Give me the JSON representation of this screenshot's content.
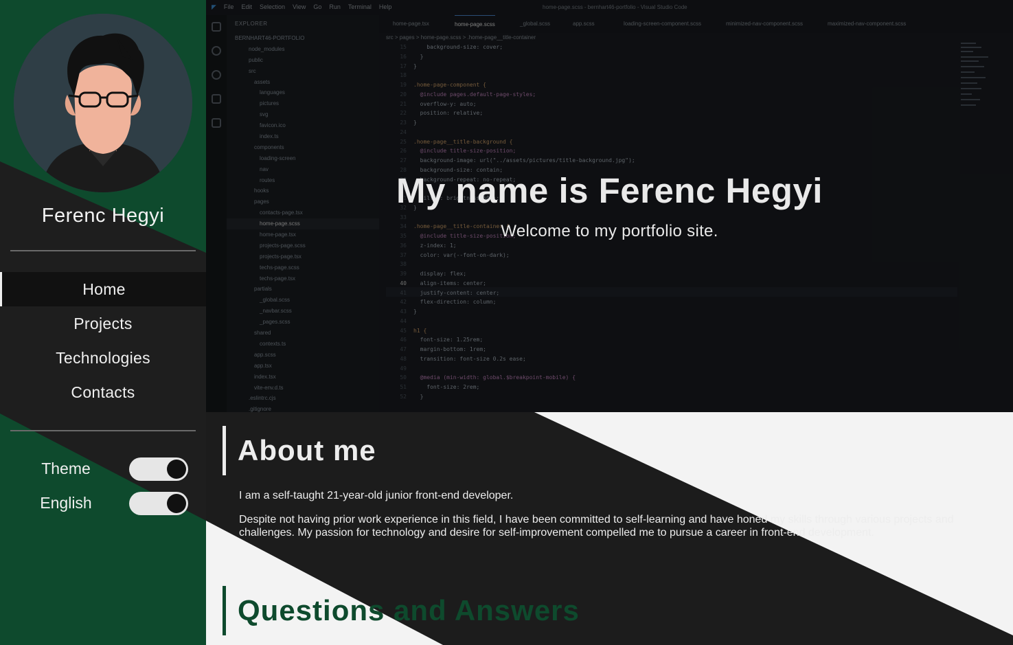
{
  "sidebar": {
    "owner_name": "Ferenc Hegyi",
    "nav": [
      {
        "label": "Home",
        "active": true
      },
      {
        "label": "Projects",
        "active": false
      },
      {
        "label": "Technologies",
        "active": false
      },
      {
        "label": "Contacts",
        "active": false
      }
    ],
    "toggles": [
      {
        "label": "Theme",
        "on": true
      },
      {
        "label": "English",
        "on": true
      }
    ]
  },
  "hero": {
    "title": "My name is Ferenc Hegyi",
    "subtitle": "Welcome to my portfolio site.",
    "editor": {
      "menu": [
        "File",
        "Edit",
        "Selection",
        "View",
        "Go",
        "Run",
        "Terminal",
        "Help"
      ],
      "window_title": "home-page.scss - bernhart46-portfolio - Visual Studio Code",
      "explorer_title": "EXPLORER",
      "project": "BERNHART46-PORTFOLIO",
      "tree": [
        "node_modules",
        "public",
        "src",
        "assets",
        "languages",
        "pictures",
        "svg",
        "favicon.ico",
        "index.ts",
        "components",
        "loading-screen",
        "nav",
        "routes",
        "hooks",
        "pages",
        "contacts-page.tsx",
        "home-page.scss",
        "home-page.tsx",
        "projects-page.scss",
        "projects-page.tsx",
        "techs-page.scss",
        "techs-page.tsx",
        "partials",
        "_global.scss",
        "_navbar.scss",
        "_pages.scss",
        "shared",
        "contexts.ts",
        "app.scss",
        "app.tsx",
        "index.tsx",
        "vite-env.d.ts",
        ".eslintrc.cjs",
        ".gitignore"
      ],
      "tabs": [
        "home-page.tsx",
        "home-page.scss",
        "_global.scss",
        "app.scss",
        "loading-screen-component.scss",
        "minimized-nav-component.scss",
        "maximized-nav-component.scss"
      ],
      "breadcrumb": "src > pages > home-page.scss > .home-page__title-container",
      "current_line": "40",
      "code": [
        "    background-size: cover;",
        "  }",
        "}",
        "",
        ".home-page-component {",
        "  @include pages.default-page-styles;",
        "  overflow-y: auto;",
        "  position: relative;",
        "}",
        "",
        ".home-page__title-background {",
        "  @include title-size-position;",
        "  background-image: url(\"../assets/pictures/title-background.jpg\");",
        "  background-size: contain;",
        "  background-repeat: no-repeat;",
        "",
        "  filter: brightness(50%);",
        "}",
        "",
        ".home-page__title-container {",
        "  @include title-size-position;",
        "  z-index: 1;",
        "  color: var(--font-on-dark);",
        "",
        "  display: flex;",
        "  align-items: center;",
        "  justify-content: center;",
        "  flex-direction: column;",
        "}",
        "",
        "h1 {",
        "  font-size: 1.25rem;",
        "  margin-bottom: 1rem;",
        "  transition: font-size 0.2s ease;",
        "",
        "  @media (min-width: global.$breakpoint-mobile) {",
        "    font-size: 2rem;",
        "  }"
      ]
    }
  },
  "about": {
    "heading": "About me",
    "paragraphs": [
      "I am a self-taught 21-year-old junior front-end developer.",
      "Despite not having prior work experience in this field, I have been committed to self-learning and have honed my skills through various projects and challenges. My passion for technology and desire for self-improvement compelled me to pursue a career in front-end development."
    ]
  },
  "qa": {
    "heading": "Questions and Answers"
  },
  "colors": {
    "brand_green": "#0e4a2d",
    "dark": "#1e1e1e",
    "light": "#f3f3f3"
  }
}
